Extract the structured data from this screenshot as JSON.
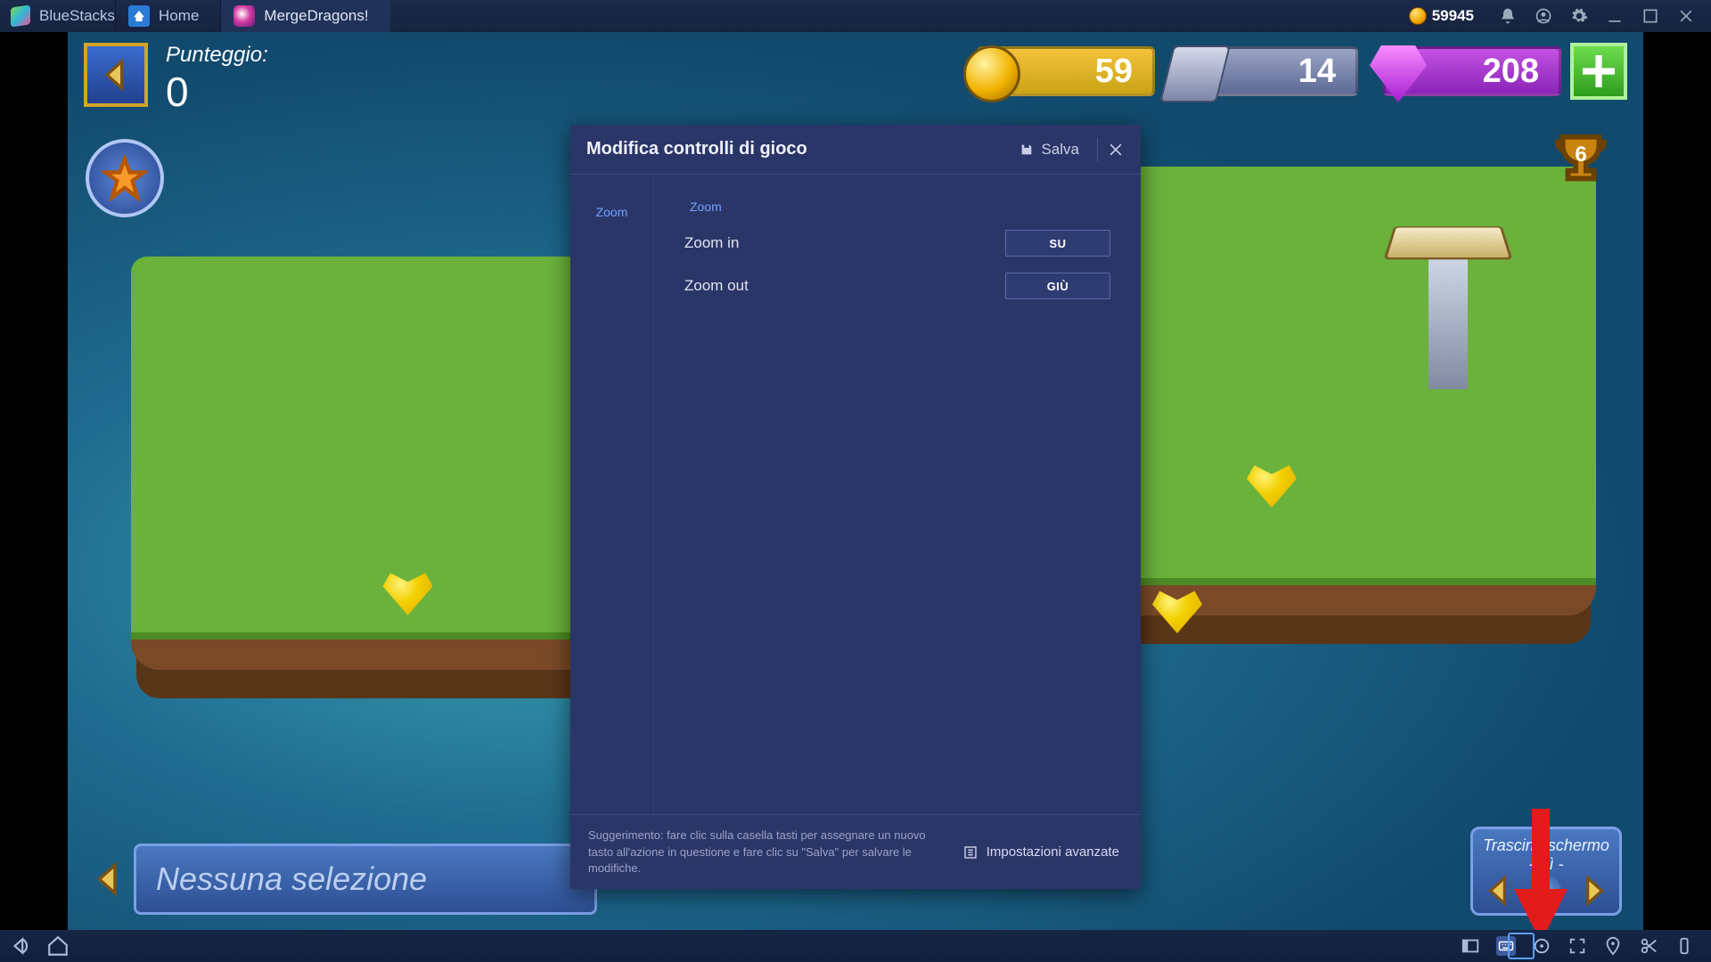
{
  "app": {
    "name": "BlueStacks"
  },
  "tabs": {
    "home": "Home",
    "game": "MergeDragons!"
  },
  "topright": {
    "coins": "59945"
  },
  "hud": {
    "score_label": "Punteggio:",
    "score_value": "0",
    "gold": "59",
    "stone": "14",
    "gems": "208",
    "trophy_count": "6"
  },
  "selection": {
    "none": "Nessuna selezione",
    "drag_label": "Trascina schermo",
    "drag_state": "- Sì -"
  },
  "modal": {
    "title": "Modifica controlli di gioco",
    "save": "Salva",
    "categories": [
      "Zoom"
    ],
    "group_label": "Zoom",
    "rows": [
      {
        "name": "Zoom in",
        "key": "SU"
      },
      {
        "name": "Zoom out",
        "key": "GIÙ"
      }
    ],
    "hint": "Suggerimento: fare clic sulla casella tasti per assegnare un nuovo tasto all'azione in questione e fare clic su \"Salva\" per salvare le modifiche.",
    "advanced": "Impostazioni avanzate"
  }
}
